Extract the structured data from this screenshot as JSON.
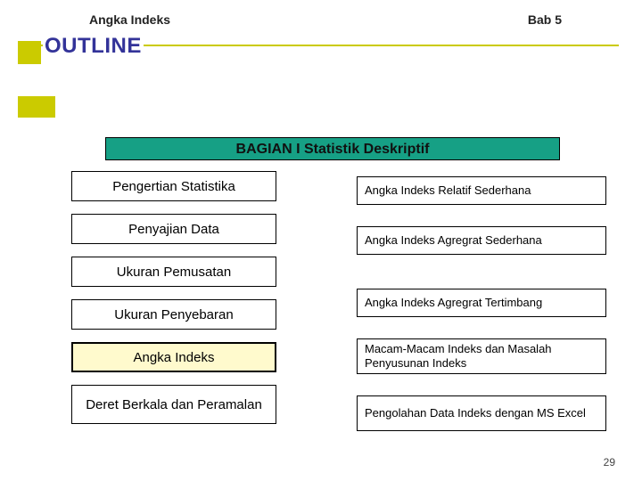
{
  "header": {
    "left": "Angka Indeks",
    "right": "Bab 5"
  },
  "title": "OUTLINE",
  "section_banner": "BAGIAN  I  Statistik Deskriptif",
  "left_boxes": [
    {
      "label": "Pengertian Statistika",
      "hl": false,
      "tall": false
    },
    {
      "label": "Penyajian Data",
      "hl": false,
      "tall": false
    },
    {
      "label": "Ukuran Pemusatan",
      "hl": false,
      "tall": false
    },
    {
      "label": "Ukuran Penyebaran",
      "hl": false,
      "tall": false
    },
    {
      "label": "Angka Indeks",
      "hl": true,
      "tall": false
    },
    {
      "label": "Deret Berkala dan Peramalan",
      "hl": false,
      "tall": true
    }
  ],
  "right_boxes": [
    {
      "label": "Angka Indeks Relatif Sederhana"
    },
    {
      "label": "Angka Indeks Agregrat Sederhana"
    },
    {
      "label": "Angka Indeks Agregrat Tertimbang"
    },
    {
      "label": "Macam-Macam Indeks\ndan Masalah Penyusunan Indeks"
    },
    {
      "label": "Pengolahan Data Indeks  dengan MS Excel"
    }
  ],
  "page_number": "29"
}
